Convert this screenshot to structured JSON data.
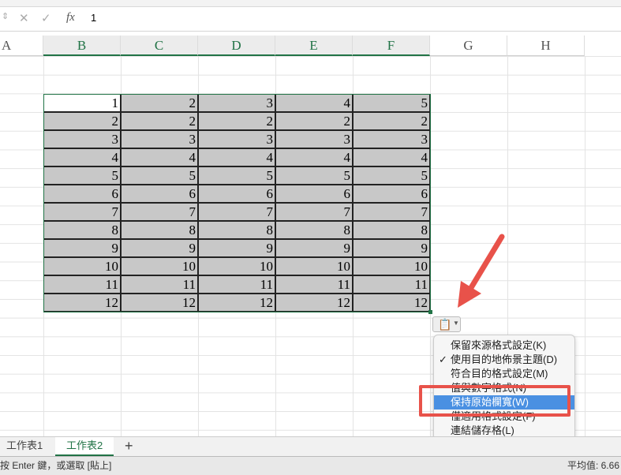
{
  "formula_bar": {
    "cancel": "✕",
    "confirm": "✓",
    "fx": "fx",
    "value": "1"
  },
  "columns": [
    "A",
    "B",
    "C",
    "D",
    "E",
    "F",
    "G",
    "H"
  ],
  "table": [
    [
      1,
      2,
      3,
      4,
      5
    ],
    [
      2,
      2,
      2,
      2,
      2
    ],
    [
      3,
      3,
      3,
      3,
      3
    ],
    [
      4,
      4,
      4,
      4,
      4
    ],
    [
      5,
      5,
      5,
      5,
      5
    ],
    [
      6,
      6,
      6,
      6,
      6
    ],
    [
      7,
      7,
      7,
      7,
      7
    ],
    [
      8,
      8,
      8,
      8,
      8
    ],
    [
      9,
      9,
      9,
      9,
      9
    ],
    [
      10,
      10,
      10,
      10,
      10
    ],
    [
      11,
      11,
      11,
      11,
      11
    ],
    [
      12,
      12,
      12,
      12,
      12
    ]
  ],
  "paste_menu": {
    "items": [
      {
        "label": "保留來源格式設定(K)",
        "checked": false
      },
      {
        "label": "使用目的地佈景主題(D)",
        "checked": true
      },
      {
        "label": "符合目的格式設定(M)",
        "checked": false
      },
      {
        "label": "值與數字格式(N)",
        "checked": false
      },
      {
        "label": "保持原始欄寬(W)",
        "checked": false,
        "highlighted": true
      },
      {
        "label": "僅適用格式設定(F)",
        "checked": false
      },
      {
        "label": "連結儲存格(L)",
        "checked": false
      }
    ],
    "check": "✓"
  },
  "sheets": {
    "tabs": [
      "工作表1",
      "工作表2"
    ],
    "active": 1,
    "add": "+"
  },
  "status": {
    "left": "按 Enter 鍵，或選取 [貼上]",
    "right": "平均值: 6.66"
  },
  "colors": {
    "accent": "#217346",
    "annotation": "#e8524a",
    "highlight": "#4a90e2"
  }
}
